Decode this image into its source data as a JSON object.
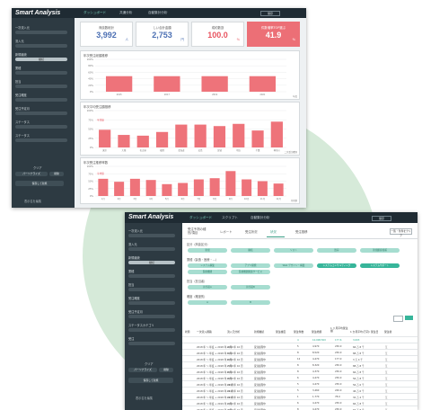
{
  "app": {
    "logo": "Smart Analysis"
  },
  "screen1": {
    "nav": [
      "ダッシュボード",
      "共通分析",
      "自動集計分析"
    ],
    "nav_active": 0,
    "top_button": "保存",
    "sidebar": {
      "fields": [
        "一次流入元",
        "流入元",
        "新規継続",
        "業種",
        "担当",
        "受注確度",
        "受注予定月",
        "ステータス"
      ],
      "selected": "継続",
      "section_label": "クリア",
      "buttons": [
        "パーソナライズ",
        "削除",
        "保存して新規",
        "設定"
      ],
      "footer": "表示名を編集"
    },
    "kpis": [
      {
        "label": "商談数総計",
        "value": "3,992",
        "unit": "人",
        "style": "blue"
      },
      {
        "label": "しい合計金額",
        "value": "2,753",
        "unit": "円",
        "style": "blue"
      },
      {
        "label": "成約数割",
        "value": "100.0",
        "unit": "%",
        "style": "pink"
      },
      {
        "label": "件数増率TOP選ぶ",
        "value": "41.9",
        "unit": "%",
        "style": "highlight"
      }
    ],
    "charts": [
      {
        "title": "年次受注総額推移",
        "type": "bar",
        "categories": [
          "2015",
          "2017",
          "2019",
          "2021"
        ],
        "values": [
          48,
          48,
          48,
          48
        ],
        "ylim": [
          0,
          100
        ],
        "yticks": [
          "100%",
          "80%",
          "60%",
          "40%",
          "20%",
          "0%"
        ],
        "right_label": "年度"
      },
      {
        "title": "年次平均受注額推移",
        "type": "bar",
        "categories": [
          "東京",
          "大阪",
          "名古屋",
          "福岡",
          "北海道",
          "広島",
          "宮城",
          "埼玉",
          "千葉",
          "神奈川"
        ],
        "values": [
          48,
          34,
          32,
          42,
          62,
          62,
          58,
          64,
          46,
          70
        ],
        "ylim": [
          0,
          100
        ],
        "yticks": [
          "100%",
          "75%",
          "50%",
          "25%",
          "0%"
        ],
        "annotation": "平均値",
        "right_label": "二次受注種別"
      },
      {
        "title": "年次受注推移率数",
        "type": "bar",
        "categories": [
          "1月",
          "2月",
          "3月",
          "4月",
          "5月",
          "6月",
          "7月",
          "8月",
          "9月",
          "10月",
          "11月",
          "12月"
        ],
        "values": [
          58,
          48,
          58,
          54,
          40,
          44,
          56,
          60,
          84,
          56,
          50,
          42
        ],
        "ylim": [
          0,
          100
        ],
        "yticks": [
          "100%",
          "75%",
          "50%",
          "25%",
          "0%"
        ],
        "annotation": "平均値",
        "right_label": "月別割"
      }
    ]
  },
  "screen2": {
    "nav": [
      "ダッシュボード",
      "スクリプト",
      "自動集計分析"
    ],
    "nav_active": 0,
    "top_button": "保存",
    "sidebar": {
      "fields": [
        "一次流入元",
        "流入元",
        "新規継続",
        "業種",
        "担当",
        "受注確度",
        "受注予定月",
        "ステータス",
        "ステータスカテゴリ",
        "受注"
      ],
      "selected": "継続",
      "section_label": "クリア",
      "buttons": [
        "パーソナライズ",
        "削除",
        "保存して新規",
        "設定"
      ],
      "footer": "表示名を編集"
    },
    "tabs": [
      "受注予測の種別/項目",
      "レポート",
      "受注状況",
      "状況",
      "受注推移"
    ],
    "tab_active": 3,
    "clear_button": "一覧・条件をクリア",
    "filters": [
      {
        "title": "区分（商談区分）",
        "pills": [
          "新規",
          "継続",
          "リスト",
          "既存",
          "新規顧客候補"
        ],
        "selected": []
      },
      {
        "title": "業種（製造・医療・…）",
        "pills": [
          "システム構築",
          "アプリ開発",
          "Web デザイン・構築",
          "システムコンサルティング",
          "システムサポート",
          "医療機関",
          "医療機器関連サービス"
        ],
        "selected": [
          3,
          4
        ]
      },
      {
        "title": "担当（担当者）",
        "pills": [
          "担当者A",
          "担当者B"
        ],
        "selected": []
      },
      {
        "title": "確度（確度別）",
        "pills": [
          "A",
          "B"
        ],
        "selected": []
      }
    ],
    "table": {
      "headers": [
        "状態",
        "一次流入経路",
        "流入元分析",
        "新規継続",
        "受注確度",
        "受注件数",
        "受注総額",
        "1 ヶ月平均受注額",
        "1 か月平均(万円)",
        "受注日",
        "受注者"
      ],
      "total": [
        "",
        "",
        "",
        "",
        "",
        "4",
        "10,008,500",
        "177.6",
        "3,003",
        "",
        ""
      ],
      "rows": [
        [
          "",
          "2018 年 ～ 年度 + 2018 年 4 月",
          "2019 年 10 月",
          "受注処理中",
          "",
          "5",
          "4,970",
          "230.0",
          "66 万 8 千",
          "",
          "江"
        ],
        [
          "",
          "2018 年 ～ 年度 + 2018 年 5 月",
          "2019 年 10 月",
          "受注処理中",
          "",
          "8",
          "8,520",
          "230.0",
          "88 万 8 千",
          "",
          "江"
        ],
        [
          "",
          "2018 年 ～ 年度 + 2018 年 6 月",
          "2019 年 10 月",
          "受注処理中",
          "",
          "12",
          "4,470",
          "177.0",
          "3 万 4 千",
          "",
          "江"
        ],
        [
          "",
          "2018 年 ～ 年度 + 2018 年 7 月",
          "2019 年 10 月",
          "受注処理中",
          "",
          "8",
          "8,320",
          "230.0",
          "88 万 8 千",
          "",
          "江"
        ],
        [
          "",
          "2018 年 ～ 年度 + 2018 年 8 月",
          "2019 年 10 月",
          "受注処理中",
          "",
          "8",
          "4,370",
          "230.0",
          "66 万 8 千",
          "",
          "江"
        ],
        [
          "",
          "2018 年 ～ 年度 + 2018 年 9 月",
          "2019 年 10 月",
          "受注処理中",
          "",
          "6",
          "4,470",
          "230.0",
          "56 万 8 千",
          "",
          "江"
        ],
        [
          "",
          "2018 年 ～ 年度 + 2018 年 10 月",
          "2019 年 10 月",
          "受注処理中",
          "",
          "5",
          "4,470",
          "230.0",
          "56 万 6 千",
          "",
          "江"
        ],
        [
          "",
          "2018 年 ～ 年度 + 2018 年 11 月",
          "2019 年 10 月",
          "受注処理中",
          "",
          "5",
          "3,460",
          "240.0",
          "46 万 6 千",
          "",
          "江"
        ],
        [
          "",
          "2018 年 ～ 年度 + 2018 年 12 月",
          "2019 年 10 月",
          "受注処理中",
          "",
          "1",
          "1,770",
          "78.0",
          "32 万 4 千",
          "",
          "江"
        ],
        [
          "",
          "2018 年 ～ 年度 + 2019 年 1 月",
          "2019 年 10 月",
          "受注処理中",
          "",
          "6",
          "4,470",
          "230.0",
          "66 万 8 千",
          "",
          "江"
        ],
        [
          "",
          "2018 年 ～ 年度 + 2019 年 2 月",
          "2019 年 10 月",
          "受注処理中",
          "",
          "8",
          "4,470",
          "230.0",
          "66 万 8 千",
          "",
          "江"
        ]
      ]
    }
  },
  "colors": {
    "bar": "#ee737a",
    "accent": "#37b59a",
    "navy": "#1f2b33",
    "side": "#2d3a42"
  }
}
